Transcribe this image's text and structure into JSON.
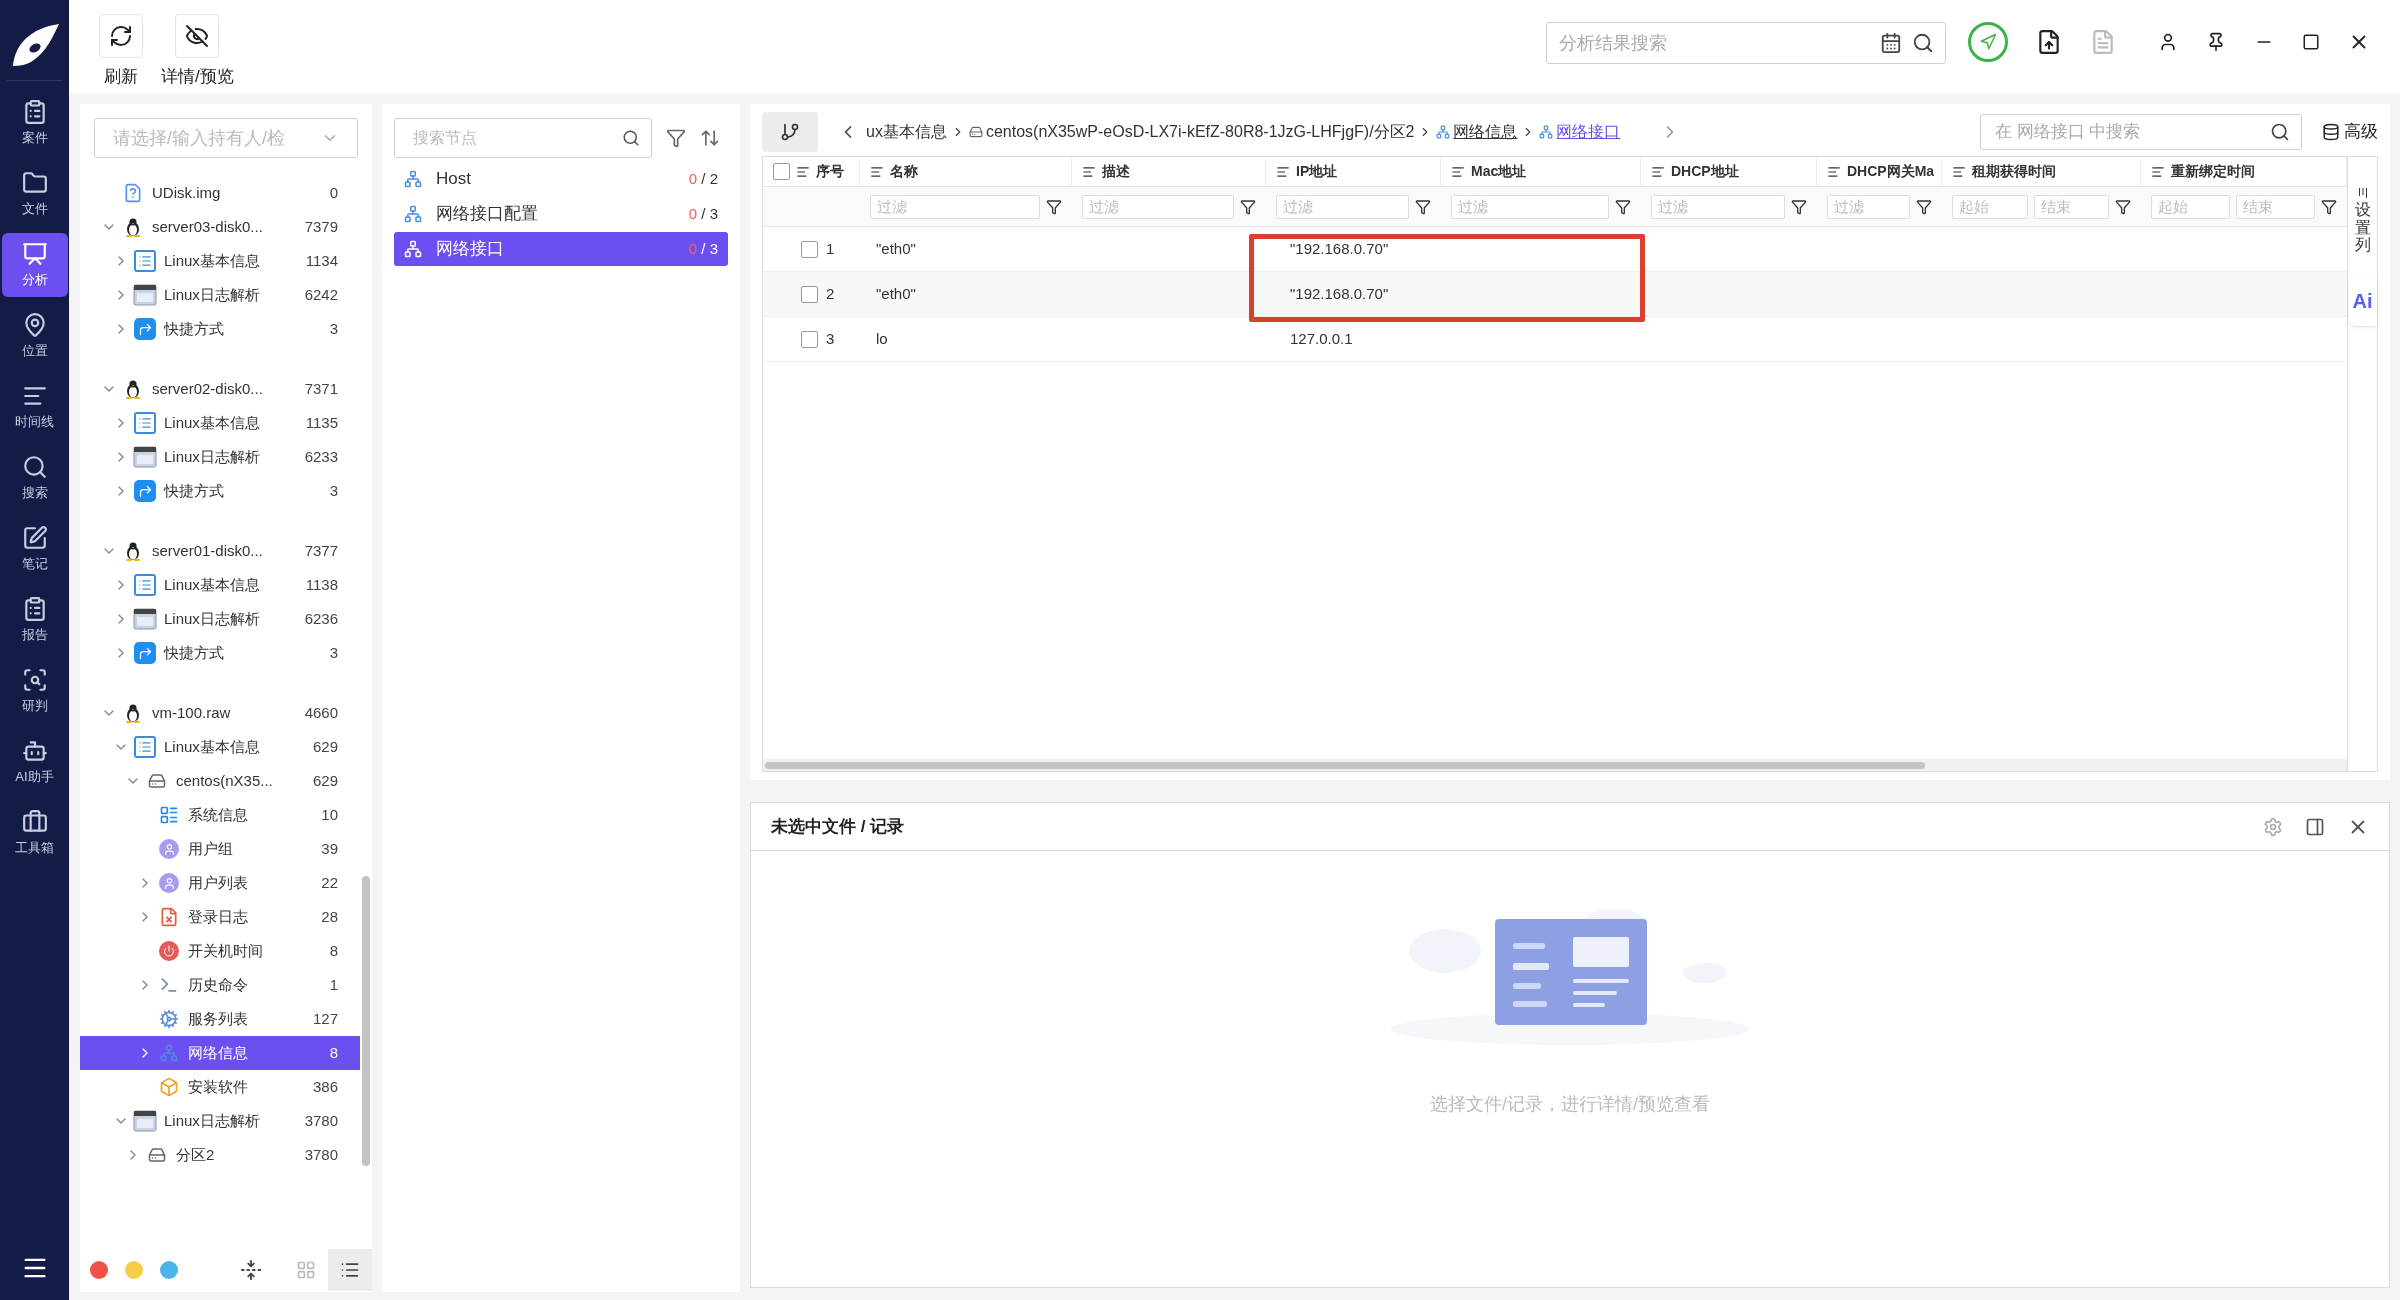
{
  "nav": [
    {
      "label": "案件",
      "selected": false
    },
    {
      "label": "文件",
      "selected": false
    },
    {
      "label": "分析",
      "selected": true
    },
    {
      "label": "位置",
      "selected": false
    },
    {
      "label": "时间线",
      "selected": false
    },
    {
      "label": "搜索",
      "selected": false
    },
    {
      "label": "笔记",
      "selected": false
    },
    {
      "label": "报告",
      "selected": false
    },
    {
      "label": "研判",
      "selected": false
    },
    {
      "label": "AI助手",
      "selected": false
    },
    {
      "label": "工具箱",
      "selected": false
    }
  ],
  "toolbar": [
    {
      "label": "刷新"
    },
    {
      "label": "详情/预览"
    }
  ],
  "result_search": {
    "placeholder": "分析结果搜索"
  },
  "owner_select": {
    "placeholder": "请选择/输入持有人/检"
  },
  "tree": [
    {
      "kind": "disk",
      "label": "UDisk.img",
      "count": "0",
      "selected": false
    },
    {
      "kind": "linux",
      "label": "server03-disk0...",
      "count": "7379",
      "selected": false,
      "expanded": true,
      "children": [
        {
          "kind": "info",
          "label": "Linux基本信息",
          "count": "1134",
          "selected": false,
          "expanded": false
        },
        {
          "kind": "log",
          "label": "Linux日志解析",
          "count": "6242",
          "selected": false,
          "expanded": false
        },
        {
          "kind": "shortcut",
          "label": "快捷方式",
          "count": "3",
          "selected": false,
          "expanded": false
        }
      ]
    },
    {
      "kind": "linux",
      "label": "server02-disk0...",
      "count": "7371",
      "selected": false,
      "expanded": true,
      "children": [
        {
          "kind": "info",
          "label": "Linux基本信息",
          "count": "1135",
          "selected": false,
          "expanded": false
        },
        {
          "kind": "log",
          "label": "Linux日志解析",
          "count": "6233",
          "selected": false,
          "expanded": false
        },
        {
          "kind": "shortcut",
          "label": "快捷方式",
          "count": "3",
          "selected": false,
          "expanded": false
        }
      ]
    },
    {
      "kind": "linux",
      "label": "server01-disk0...",
      "count": "7377",
      "selected": false,
      "expanded": true,
      "children": [
        {
          "kind": "info",
          "label": "Linux基本信息",
          "count": "1138",
          "selected": false,
          "expanded": false
        },
        {
          "kind": "log",
          "label": "Linux日志解析",
          "count": "6236",
          "selected": false,
          "expanded": false
        },
        {
          "kind": "shortcut",
          "label": "快捷方式",
          "count": "3",
          "selected": false,
          "expanded": false
        }
      ]
    },
    {
      "kind": "linux",
      "label": "vm-100.raw",
      "count": "4660",
      "selected": false,
      "expanded": true,
      "children": [
        {
          "kind": "info",
          "label": "Linux基本信息",
          "count": "629",
          "selected": false,
          "expanded": true,
          "children": [
            {
              "kind": "drive",
              "label": "centos(nX35...",
              "count": "629",
              "selected": false,
              "expanded": true,
              "children": [
                {
                  "kind": "sysinfo",
                  "label": "系统信息",
                  "count": "10",
                  "selected": false
                },
                {
                  "kind": "user",
                  "label": "用户组",
                  "count": "39",
                  "selected": false
                },
                {
                  "kind": "user",
                  "label": "用户列表",
                  "count": "22",
                  "selected": false,
                  "expanded": false
                },
                {
                  "kind": "login",
                  "label": "登录日志",
                  "count": "28",
                  "selected": false,
                  "expanded": false
                },
                {
                  "kind": "power",
                  "label": "开关机时间",
                  "count": "8",
                  "selected": false
                },
                {
                  "kind": "terminal",
                  "label": "历史命令",
                  "count": "1",
                  "selected": false,
                  "expanded": false
                },
                {
                  "kind": "service",
                  "label": "服务列表",
                  "count": "127",
                  "selected": false
                },
                {
                  "kind": "network",
                  "label": "网络信息",
                  "count": "8",
                  "selected": true,
                  "expanded": false
                },
                {
                  "kind": "software",
                  "label": "安装软件",
                  "count": "386",
                  "selected": false
                }
              ]
            }
          ]
        },
        {
          "kind": "log",
          "label": "Linux日志解析",
          "count": "3780",
          "selected": false,
          "expanded": true,
          "children": [
            {
              "kind": "drive",
              "label": "分区2",
              "count": "3780",
              "selected": false,
              "expanded": false
            }
          ]
        }
      ]
    }
  ],
  "color_tags": [
    {
      "color": "#f0524a"
    },
    {
      "color": "#f7cd46"
    },
    {
      "color": "#4cb4ec"
    }
  ],
  "view_modes": [
    {
      "selected": false
    },
    {
      "selected": true
    }
  ],
  "node_search": {
    "placeholder": "搜索节点"
  },
  "nodes": [
    {
      "label": "Host",
      "done": "0",
      "rest": "/ 2",
      "selected": false
    },
    {
      "label": "网络接口配置",
      "done": "0",
      "rest": "/ 3",
      "selected": false
    },
    {
      "label": "网络接口",
      "done": "0",
      "rest": "/ 3",
      "selected": true
    }
  ],
  "breadcrumb": [
    {
      "kind": "text",
      "label": "ux基本信息"
    },
    {
      "kind": "drive",
      "label": "centos(nX35wP-eOsD-LX7i-kEfZ-80R8-1JzG-LHFjgF)/分区2"
    },
    {
      "kind": "net",
      "label": "网络信息"
    },
    {
      "kind": "current",
      "label": "网络接口"
    }
  ],
  "table_search": {
    "placeholder": "在 网络接口 中搜索"
  },
  "advanced": "高级",
  "table": {
    "all_checked": false,
    "columns": [
      {
        "label": "序号"
      },
      {
        "label": "名称",
        "filters": [
          "过滤"
        ]
      },
      {
        "label": "描述",
        "filters": [
          "过滤"
        ]
      },
      {
        "label": "IP地址",
        "filters": [
          "过滤"
        ]
      },
      {
        "label": "Mac地址",
        "filters": [
          "过滤"
        ]
      },
      {
        "label": "DHCP地址",
        "filters": [
          "过滤"
        ]
      },
      {
        "label": "DHCP网关Ma",
        "filters": [
          "过滤"
        ]
      },
      {
        "label": "租期获得时间",
        "filters": [
          "起始",
          "结束"
        ]
      },
      {
        "label": "重新绑定时间",
        "filters": [
          "起始",
          "结束"
        ]
      }
    ],
    "rows": [
      {
        "checked": false,
        "cells": [
          "1",
          "\"eth0\"",
          "",
          "\"192.168.0.70\"",
          "",
          "",
          "",
          "",
          ""
        ]
      },
      {
        "checked": false,
        "cells": [
          "2",
          "\"eth0\"",
          "",
          "\"192.168.0.70\"",
          "",
          "",
          "",
          "",
          ""
        ]
      },
      {
        "checked": false,
        "cells": [
          "3",
          "lo",
          "",
          "127.0.0.1",
          "",
          "",
          "",
          "",
          ""
        ]
      }
    ]
  },
  "column_settings": "设置列",
  "ai_button": "Ai",
  "detail": {
    "title": "未选中文件 / 记录",
    "empty_text": "选择文件/记录，进行详情/预览查看"
  }
}
